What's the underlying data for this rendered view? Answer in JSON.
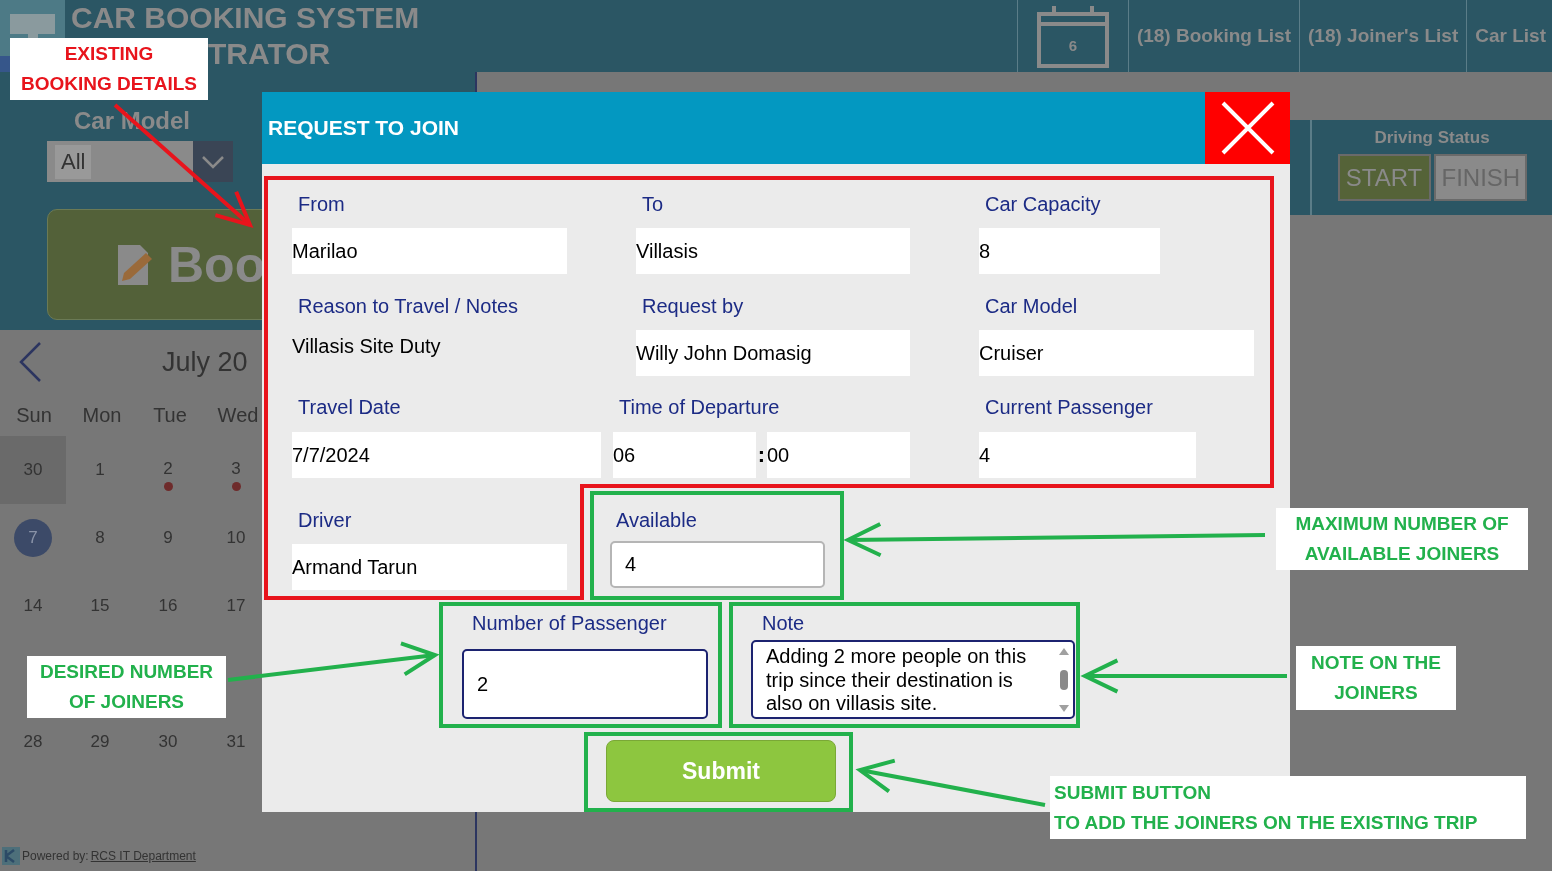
{
  "header": {
    "title": "CAR BOOKING SYSTEM",
    "subtitle": "TRATOR",
    "calendar_badge": "6",
    "nav": [
      {
        "label": "(18) Booking List"
      },
      {
        "label": "(18) Joiner's List"
      },
      {
        "label": "Car List"
      }
    ]
  },
  "filter": {
    "label": "Car Model",
    "value": "All"
  },
  "book_button": {
    "label": "Boo"
  },
  "calendar": {
    "month": "July 20",
    "weekdays": [
      "Sun",
      "Mon",
      "Tue",
      "Wed"
    ],
    "weeks": [
      [
        {
          "day": "30",
          "selected": false,
          "event": false,
          "shaded": true
        },
        {
          "day": "1",
          "selected": false,
          "event": false,
          "shaded": false
        },
        {
          "day": "2",
          "selected": false,
          "event": true,
          "shaded": false
        },
        {
          "day": "3",
          "selected": false,
          "event": true,
          "shaded": false
        }
      ],
      [
        {
          "day": "7",
          "selected": true,
          "event": false,
          "shaded": false
        },
        {
          "day": "8",
          "selected": false,
          "event": false,
          "shaded": false
        },
        {
          "day": "9",
          "selected": false,
          "event": false,
          "shaded": false
        },
        {
          "day": "10",
          "selected": false,
          "event": false,
          "shaded": false
        }
      ],
      [
        {
          "day": "14",
          "selected": false,
          "event": false,
          "shaded": false
        },
        {
          "day": "15",
          "selected": false,
          "event": false,
          "shaded": false
        },
        {
          "day": "16",
          "selected": false,
          "event": false,
          "shaded": false
        },
        {
          "day": "17",
          "selected": false,
          "event": false,
          "shaded": false
        }
      ],
      [
        {
          "day": "28",
          "selected": false,
          "event": false,
          "shaded": false
        },
        {
          "day": "29",
          "selected": false,
          "event": false,
          "shaded": false
        },
        {
          "day": "30",
          "selected": false,
          "event": false,
          "shaded": false
        },
        {
          "day": "31",
          "selected": false,
          "event": false,
          "shaded": false
        }
      ]
    ]
  },
  "footer": {
    "prefix": "Powered by:",
    "link": "RCS IT Department"
  },
  "driving_status": {
    "label": "Driving Status",
    "buttons": [
      {
        "label": "START",
        "kind": "start"
      },
      {
        "label": "FINISH",
        "kind": "finish"
      }
    ]
  },
  "dialog": {
    "title": "REQUEST TO JOIN",
    "fields": [
      {
        "label": "From",
        "kind": "input",
        "value": "Marilao"
      },
      {
        "label": "To",
        "kind": "input",
        "value": "Villasis"
      },
      {
        "label": "Car Capacity",
        "kind": "input",
        "value": "8"
      },
      {
        "label": "Reason to Travel / Notes",
        "kind": "text",
        "value": "Villasis Site Duty"
      },
      {
        "label": "Request by",
        "kind": "input",
        "value": "Willy John Domasig"
      },
      {
        "label": "Car Model",
        "kind": "input",
        "value": "Cruiser"
      },
      {
        "label": "Travel Date",
        "kind": "input",
        "value": "7/7/2024"
      },
      {
        "label": "Time of Departure",
        "kind": "time",
        "hour": "06",
        "separator": ":",
        "minute": "00"
      },
      {
        "label": "Current Passenger",
        "kind": "input",
        "value": "4"
      },
      {
        "label": "Driver",
        "kind": "input",
        "value": "Armand Tarun"
      }
    ],
    "available": {
      "label": "Available",
      "value": "4"
    },
    "passengers": {
      "label": "Number of Passenger",
      "value": "2"
    },
    "note": {
      "label": "Note",
      "value": "Adding 2 more people on this trip since their destination is also on villasis site."
    },
    "submit": "Submit"
  },
  "annotations": [
    {
      "text": "EXISTING\nBOOKING DETAILS",
      "color": "#e8141c"
    },
    {
      "text": "MAXIMUM NUMBER OF\nAVAILABLE JOINERS",
      "color": "#22b14c"
    },
    {
      "text": "DESIRED NUMBER\nOF JOINERS",
      "color": "#22b14c"
    },
    {
      "text": "NOTE ON THE\nJOINERS",
      "color": "#22b14c"
    },
    {
      "text": "SUBMIT BUTTON\nTO ADD THE JOINERS ON THE EXISTING TRIP",
      "color": "#22b14c"
    }
  ]
}
